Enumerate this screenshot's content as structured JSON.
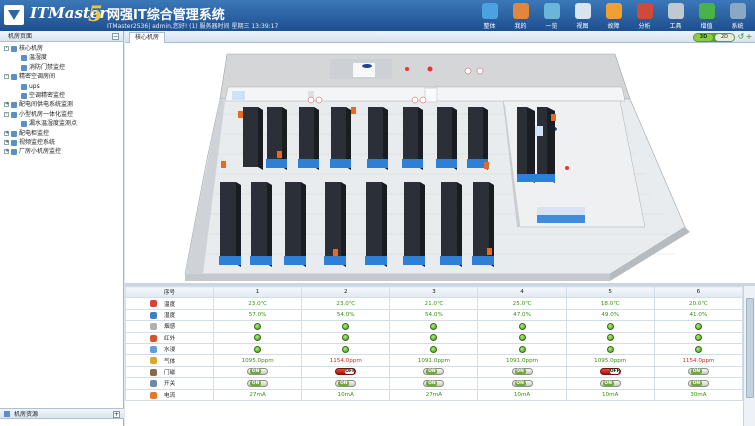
{
  "header": {
    "logo": "ITMaster",
    "logo_version": "5",
    "title": "网强IT综合管理系统",
    "subtitle": "ITMaster2536| admin,您好! (1) 服务器时间 星期三 13:39:17"
  },
  "toolbar": [
    {
      "label": "整体",
      "icon": "monitor-icon",
      "color": "#4aa3e0"
    },
    {
      "label": "我的",
      "icon": "user-icon",
      "color": "#e1863a"
    },
    {
      "label": "一览",
      "icon": "overview-icon",
      "color": "#6ab5d8"
    },
    {
      "label": "视图",
      "icon": "view-icon",
      "color": "#d8e4ee"
    },
    {
      "label": "故障",
      "icon": "alarm-icon",
      "color": "#f0a030"
    },
    {
      "label": "分析",
      "icon": "analysis-icon",
      "color": "#cf4a3a"
    },
    {
      "label": "工具",
      "icon": "tools-icon",
      "color": "#c0c8d0"
    },
    {
      "label": "增值",
      "icon": "plus-icon",
      "color": "#47b348"
    },
    {
      "label": "系统",
      "icon": "gear-icon",
      "color": "#8aa8c4"
    }
  ],
  "sidebar": {
    "header": "机房页面",
    "items": [
      {
        "label": "核心机房",
        "level": 1,
        "toggle": "-"
      },
      {
        "label": "温湿度",
        "level": 2
      },
      {
        "label": "消防门禁监控",
        "level": 2
      },
      {
        "label": "精密空调房间",
        "level": 1,
        "toggle": "-"
      },
      {
        "label": "ups",
        "level": 2
      },
      {
        "label": "空调精密监控",
        "level": 2
      },
      {
        "label": "配电间供电系统监测",
        "level": 1,
        "toggle": "+"
      },
      {
        "label": "小型机房一体化监控",
        "level": 1,
        "toggle": "-"
      },
      {
        "label": "漏水温湿度监测点",
        "level": 2
      },
      {
        "label": "配电柜监控",
        "level": 1,
        "toggle": "+"
      },
      {
        "label": "视频监控系统",
        "level": 1,
        "toggle": "+"
      },
      {
        "label": "厂房小机房监控",
        "level": 1,
        "toggle": "+"
      }
    ],
    "footer": "机房资源"
  },
  "main": {
    "tab": "核心机房",
    "view_3d": "3D",
    "view_2d": "2D"
  },
  "table": {
    "headers": [
      "序号",
      "1",
      "2",
      "3",
      "4",
      "5",
      "6"
    ],
    "rows": [
      {
        "label": "温度",
        "icon_color": "#d5433b",
        "type": "text",
        "values": [
          "23.0℃",
          "23.0℃",
          "21.0℃",
          "25.0℃",
          "18.0℃",
          "20.0℃"
        ],
        "colors": [
          "green",
          "green",
          "green",
          "green",
          "green",
          "green"
        ]
      },
      {
        "label": "湿度",
        "icon_color": "#3f7fc5",
        "type": "text",
        "values": [
          "57.0%",
          "54.0%",
          "54.0%",
          "47.0%",
          "49.0%",
          "41.0%"
        ],
        "colors": [
          "green",
          "green",
          "green",
          "green",
          "green",
          "green"
        ]
      },
      {
        "label": "烟感",
        "icon_color": "#b0b0b0",
        "type": "dot"
      },
      {
        "label": "红外",
        "icon_color": "#d7532d",
        "type": "dot"
      },
      {
        "label": "水浸",
        "icon_color": "#5fa0d8",
        "type": "dot"
      },
      {
        "label": "气体",
        "icon_color": "#e0a429",
        "type": "text",
        "values": [
          "1095.0ppm",
          "1154.0ppm",
          "1091.0ppm",
          "1091.0ppm",
          "1095.0ppm",
          "1154.0ppm"
        ],
        "colors": [
          "green",
          "red",
          "green",
          "green",
          "green",
          "red"
        ]
      },
      {
        "label": "门磁",
        "icon_color": "#8a6a4c",
        "type": "toggle",
        "states": [
          "ON",
          "OFF",
          "ON",
          "ON",
          "OFF",
          "ON"
        ]
      },
      {
        "label": "开关",
        "icon_color": "#6a8aa8",
        "type": "toggle",
        "states": [
          "ON",
          "ON",
          "ON",
          "ON",
          "ON",
          "ON"
        ]
      },
      {
        "label": "电流",
        "icon_color": "#e17a2a",
        "type": "text",
        "values": [
          "27mA",
          "10mA",
          "27mA",
          "10mA",
          "10mA",
          "30mA"
        ],
        "colors": [
          "green",
          "green",
          "green",
          "green",
          "green",
          "green"
        ]
      }
    ]
  }
}
